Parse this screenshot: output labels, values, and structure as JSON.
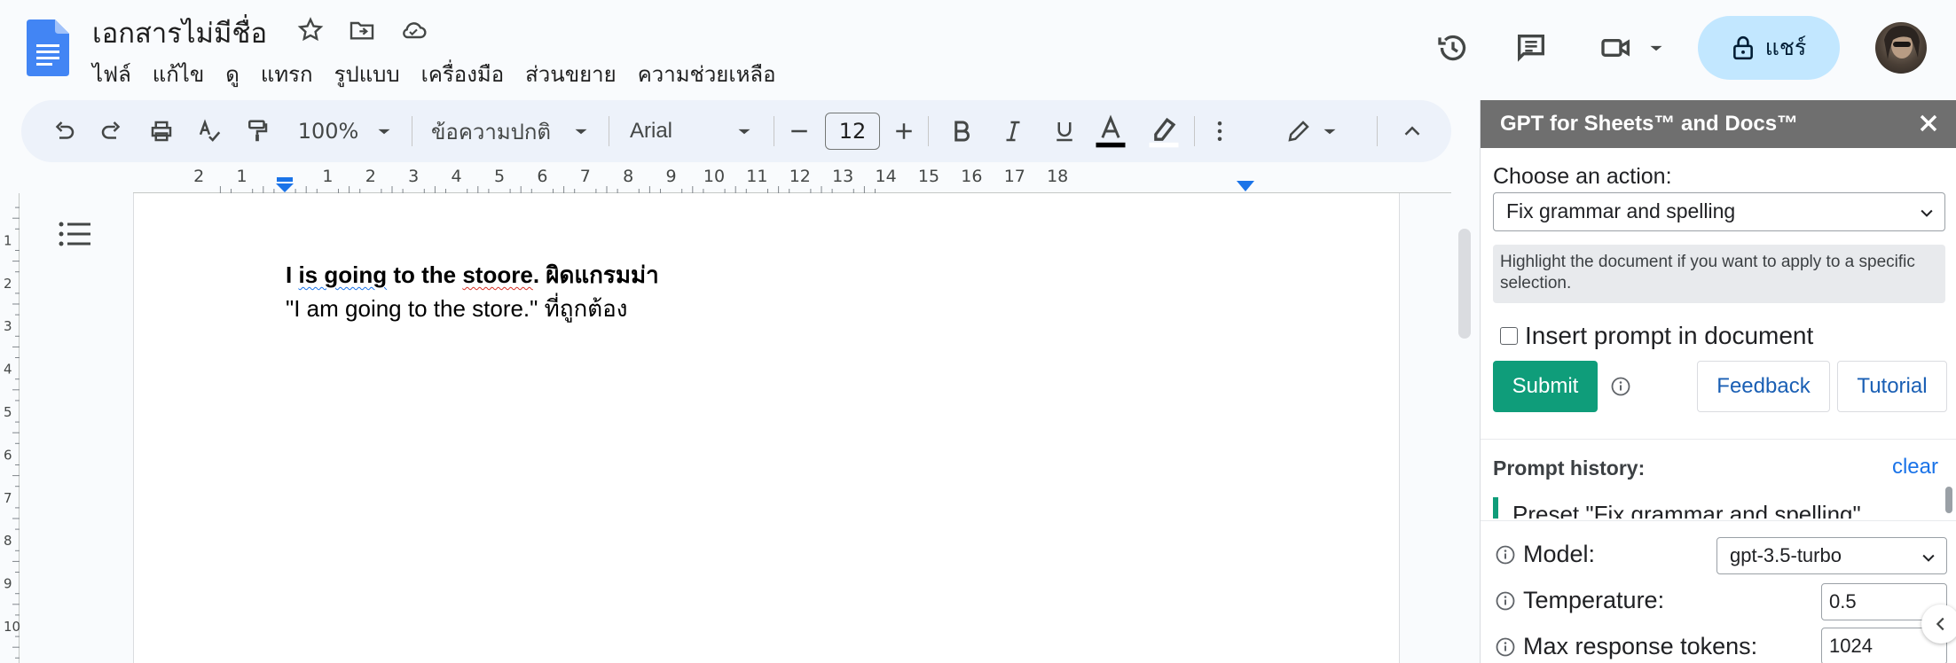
{
  "document": {
    "title": "เอกสารไม่มีชื่อ",
    "line1_part1": "I ",
    "line1_part2": "is going",
    "line1_part3": " to the ",
    "line1_part4": "stoore",
    "line1_part5": ". ผิดแกรมม่า",
    "line2": "\"I am going to the store.\" ที่ถูกต้อง"
  },
  "menu": [
    "ไฟล์",
    "แก้ไข",
    "ดู",
    "แทรก",
    "รูปแบบ",
    "เครื่องมือ",
    "ส่วนขยาย",
    "ความช่วยเหลือ"
  ],
  "header": {
    "share_label": "แชร์"
  },
  "toolbar": {
    "zoom": "100%",
    "style": "ข้อความปกติ",
    "font": "Arial",
    "font_size": "12"
  },
  "ruler": {
    "numbers": [
      "2",
      "1",
      "1",
      "2",
      "3",
      "4",
      "5",
      "6",
      "7",
      "8",
      "9",
      "10",
      "11",
      "12",
      "13",
      "14",
      "15",
      "16",
      "17",
      "18"
    ]
  },
  "sidebar": {
    "title": "GPT for Sheets™ and Docs™",
    "choose_label": "Choose an action:",
    "action_value": "Fix grammar and spelling",
    "hint": "Highlight the document if you want to apply to a specific selection.",
    "insert_prompt_label": "Insert prompt in document",
    "submit_label": "Submit",
    "feedback_label": "Feedback",
    "tutorial_label": "Tutorial",
    "prompt_history_label": "Prompt history:",
    "clear_label": "clear",
    "history_item": "Preset \"Fix grammar and spelling\"",
    "model_label": "Model:",
    "model_value": "gpt-3.5-turbo",
    "temperature_label": "Temperature:",
    "temperature_value": "0.5",
    "max_tokens_label": "Max response tokens:",
    "max_tokens_value": "1024"
  },
  "colors": {
    "accent": "#0f9d7a",
    "share_bg": "#c2e7ff",
    "doc_blue": "#4285f4"
  }
}
